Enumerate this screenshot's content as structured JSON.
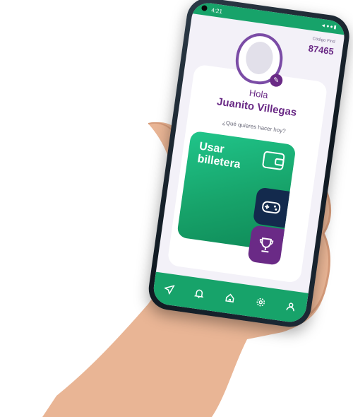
{
  "status_bar": {
    "time": "4:21",
    "signal": "◄●●▮"
  },
  "profile": {
    "code_label": "Código Find",
    "code_value": "87465",
    "greeting": "Hola",
    "name": "Juanito Villegas",
    "question": "¿Qué quieres hacer hoy?"
  },
  "actions": {
    "wallet_label": "Usar billetera"
  },
  "nav": {
    "items": [
      {
        "icon": "navigation-icon"
      },
      {
        "icon": "bell-icon"
      },
      {
        "icon": "home-icon"
      },
      {
        "icon": "gear-icon"
      },
      {
        "icon": "user-icon"
      }
    ]
  },
  "colors": {
    "brand_green": "#17a36a",
    "brand_purple": "#6a2a86",
    "brand_navy": "#132a4d"
  }
}
